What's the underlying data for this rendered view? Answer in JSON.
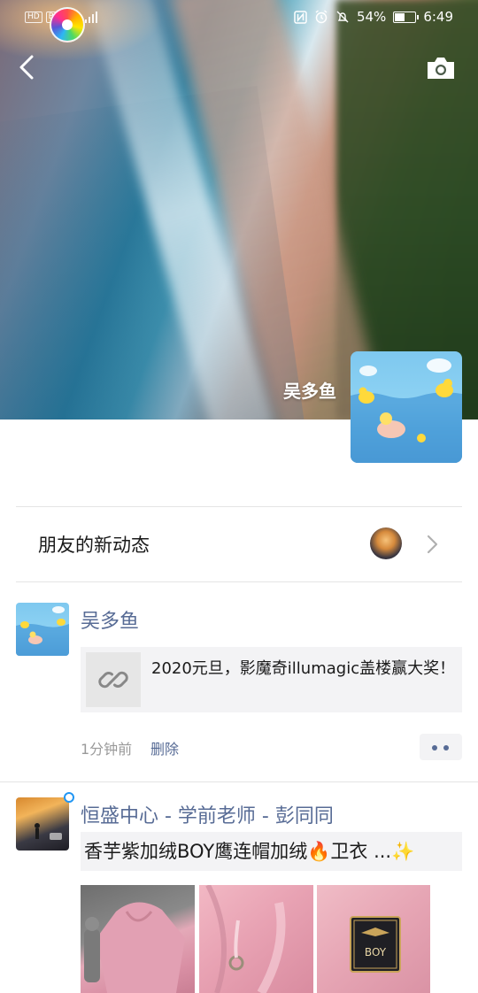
{
  "status_bar": {
    "badges": [
      "HD",
      "B"
    ],
    "battery_percent_text": "54%",
    "battery_level": 0.54,
    "time": "6:49"
  },
  "header": {
    "back_icon": "chevron-left-icon",
    "camera_icon": "camera-icon",
    "cover_name": "吴多鱼",
    "avatar_caption": "Little Yellow Duck"
  },
  "friends_updates": {
    "title": "朋友的新动态",
    "chevron_icon": "chevron-right-icon"
  },
  "posts": [
    {
      "author": "吴多鱼",
      "link_text": "2020元旦，影魔奇illumagic盖楼赢大奖！",
      "link_icon": "link-icon",
      "time": "1分钟前",
      "delete_label": "删除",
      "more_icon": "more-dots-icon"
    },
    {
      "author": "恒盛中心 - 学前老师 - 彭同同",
      "text": "香芋紫加绒BOY鹰连帽加绒🔥卫衣 ...✨",
      "photo_badge_text": "BOY"
    }
  ],
  "colors": {
    "link_blue": "#576b95",
    "card_bg": "#f3f3f5",
    "online_dot": "#2196f3"
  }
}
